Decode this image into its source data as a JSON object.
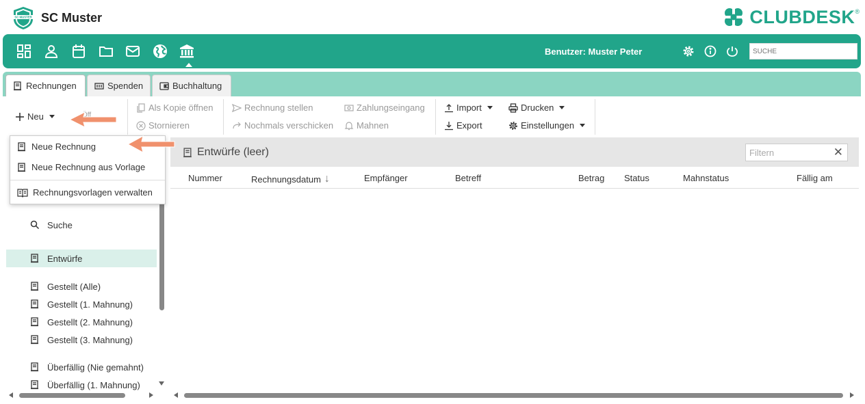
{
  "header": {
    "club_name": "SC Muster",
    "club_logo_text": "SC MUSTER",
    "brand": "CLUBDESK",
    "brand_reg": "®"
  },
  "nav": {
    "user_label": "Benutzer: Muster Peter",
    "search_placeholder": "SUCHE",
    "icons": [
      "dashboard-icon",
      "person-icon",
      "calendar-icon",
      "folder-icon",
      "mail-icon",
      "globe-icon",
      "bank-icon"
    ],
    "right_icons": [
      "gear-icon",
      "info-icon",
      "power-icon"
    ]
  },
  "tabs": [
    {
      "label": "Rechnungen",
      "icon": "invoice-icon",
      "active": true
    },
    {
      "label": "Spenden",
      "icon": "donation-icon",
      "active": false
    },
    {
      "label": "Buchhaltung",
      "icon": "wallet-icon",
      "active": false
    }
  ],
  "toolbar": {
    "new_label": "Neu",
    "partial_label": "Öff",
    "copy_label": "Als Kopie öffnen",
    "cancel_label": "Stornieren",
    "issue_label": "Rechnung stellen",
    "resend_label": "Nochmals verschicken",
    "payment_label": "Zahlungseingang",
    "remind_label": "Mahnen",
    "import_label": "Import",
    "export_label": "Export",
    "print_label": "Drucken",
    "settings_label": "Einstellungen"
  },
  "dropdown": {
    "items": [
      {
        "label": "Neue Rechnung"
      },
      {
        "label": "Neue Rechnung aus Vorlage"
      },
      {
        "label": "Rechnungsvorlagen verwalten"
      }
    ]
  },
  "sidebar": {
    "items": [
      {
        "label": "Suche",
        "icon": "search-icon"
      },
      {
        "label": "Entwürfe",
        "icon": "invoice-icon",
        "active": true
      },
      {
        "label": "Gestellt (Alle)",
        "icon": "invoice-icon"
      },
      {
        "label": "Gestellt (1. Mahnung)",
        "icon": "invoice-icon"
      },
      {
        "label": "Gestellt (2. Mahnung)",
        "icon": "invoice-icon"
      },
      {
        "label": "Gestellt (3. Mahnung)",
        "icon": "invoice-icon"
      },
      {
        "label": "Überfällig (Nie gemahnt)",
        "icon": "invoice-icon"
      },
      {
        "label": "Überfällig (1. Mahnung)",
        "icon": "invoice-icon"
      }
    ]
  },
  "panel": {
    "title": "Entwürfe (leer)",
    "filter_placeholder": "Filtern",
    "filter_clear": "✕",
    "columns": [
      "Nummer",
      "Rechnungsdatum",
      "Empfänger",
      "Betreff",
      "Betrag",
      "Status",
      "Mahnstatus",
      "Fällig am"
    ],
    "sort_indicator": "↓"
  },
  "colors": {
    "brand_green": "#21a58a",
    "tab_bar": "#8bd5c2",
    "annotation_arrow": "#f0916d",
    "active_row": "#daf0ea"
  }
}
